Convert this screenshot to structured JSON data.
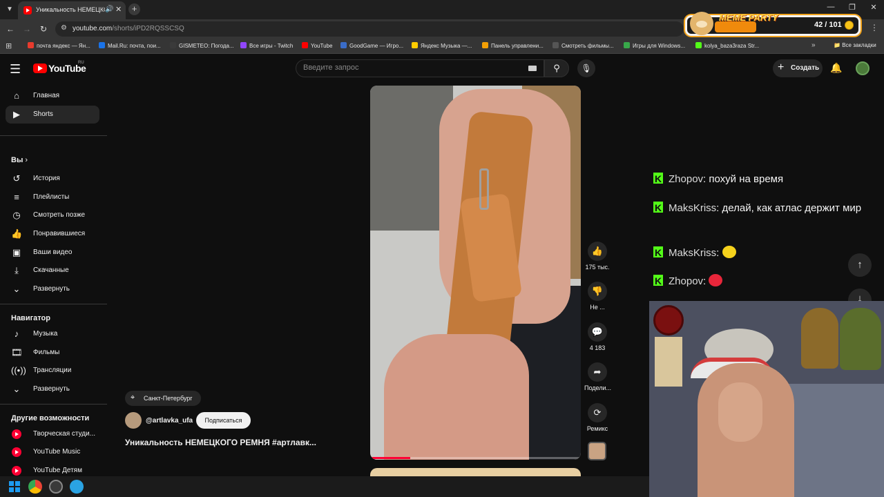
{
  "browser": {
    "tab_title": "Уникальность НЕМЕЦКОГО",
    "tab_audio_icon": "speaker-icon",
    "url_host": "youtube.com",
    "url_path": "/shorts/iPD2RQSSCSQ",
    "bookmarks": [
      {
        "label": "почта яндекс — Ян...",
        "color": "#e83b2d"
      },
      {
        "label": "Mail.Ru: почта, пои...",
        "color": "#1a73e8"
      },
      {
        "label": "GISMETEO: Погода...",
        "color": "#3a3a3a"
      },
      {
        "label": "Все игры - Twitch",
        "color": "#9146ff"
      },
      {
        "label": "YouTube",
        "color": "#ff0000"
      },
      {
        "label": "GoodGame — Игро...",
        "color": "#3a6cc7"
      },
      {
        "label": "Яндекс Музыка —...",
        "color": "#ffcc00"
      },
      {
        "label": "Панель управлени...",
        "color": "#f29f05"
      },
      {
        "label": "Смотреть фильмы...",
        "color": "#555555"
      },
      {
        "label": "Игры для Windows...",
        "color": "#38a84a"
      },
      {
        "label": "kolya_baza3raza Str...",
        "color": "#53fc18"
      }
    ],
    "all_bookmarks": "Все закладки"
  },
  "meme_party": {
    "title": "MEME PARTY",
    "count": "42 / 101"
  },
  "header": {
    "logo_text": "YouTube",
    "region": "RU",
    "search_placeholder": "Введите запрос",
    "create_label": "Создать"
  },
  "sidebar": {
    "main": [
      {
        "label": "Главная",
        "icon": "home-icon"
      },
      {
        "label": "Shorts",
        "icon": "shorts-icon"
      }
    ],
    "you_heading": "Вы",
    "you_items": [
      {
        "label": "История",
        "icon": "history-icon"
      },
      {
        "label": "Плейлисты",
        "icon": "playlists-icon"
      },
      {
        "label": "Смотреть позже",
        "icon": "watch-later-icon"
      },
      {
        "label": "Понравившиеся",
        "icon": "liked-icon"
      },
      {
        "label": "Ваши видео",
        "icon": "your-videos-icon"
      },
      {
        "label": "Скачанные",
        "icon": "downloads-icon"
      },
      {
        "label": "Развернуть",
        "icon": "chevron-down-icon"
      }
    ],
    "nav_heading": "Навигатор",
    "nav_items": [
      {
        "label": "Музыка",
        "icon": "music-icon"
      },
      {
        "label": "Фильмы",
        "icon": "movies-icon"
      },
      {
        "label": "Трансляции",
        "icon": "live-icon"
      },
      {
        "label": "Развернуть",
        "icon": "chevron-down-icon"
      }
    ],
    "more_heading": "Другие возможности",
    "more_items": [
      {
        "label": "Творческая студи...",
        "icon": "yt-studio-icon"
      },
      {
        "label": "YouTube Music",
        "icon": "yt-music-icon"
      },
      {
        "label": "YouTube Детям",
        "icon": "yt-kids-icon"
      }
    ]
  },
  "short": {
    "location": "Санкт-Петербург",
    "channel": "@artlavka_ufa",
    "subscribe_label": "Подписаться",
    "title": "Уникальность НЕМЕЦКОГО РЕМНЯ #артлавк...",
    "progress": 0.19
  },
  "actions": {
    "likes": "175 тыс.",
    "dislike": "Не ...",
    "comments": "4 183",
    "share": "Подели...",
    "remix": "Ремикс"
  },
  "chat": [
    {
      "user": "Zhopov",
      "message": "похуй на время"
    },
    {
      "user": "MaksKriss",
      "message": "делай, как атлас держит мир"
    },
    {
      "user": "MaksKriss",
      "message": "",
      "emote_color": "#f6d21c"
    },
    {
      "user": "Zhopov",
      "message": "",
      "emote_color": "#e8263a"
    }
  ]
}
